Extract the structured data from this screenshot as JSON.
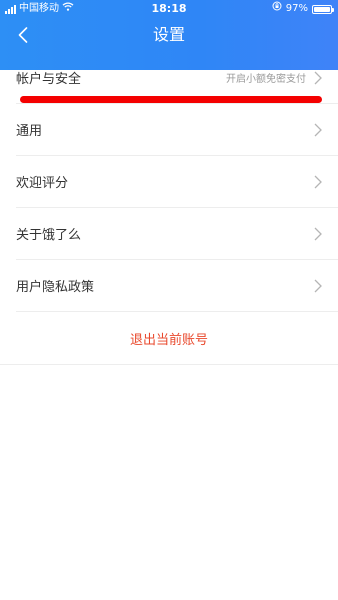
{
  "status_bar": {
    "carrier": "中国移动",
    "time": "18:18",
    "battery_percent": "97%",
    "battery_level": 0.97
  },
  "nav": {
    "title": "设置"
  },
  "settings_items": [
    {
      "label": "帐户与安全",
      "hint": "开启小额免密支付"
    },
    {
      "label": "通用"
    },
    {
      "label": "欢迎评分"
    },
    {
      "label": "关于饿了么"
    },
    {
      "label": "用户隐私政策"
    }
  ],
  "logout_label": "退出当前账号",
  "colors": {
    "header": "#2f86f6",
    "logout_text": "#e9492d",
    "annotation_line": "#f40000"
  },
  "icons": [
    "signal-icon",
    "wifi-icon",
    "back-chevron-icon",
    "orientation-lock-icon",
    "battery-icon",
    "chevron-right-icon"
  ]
}
